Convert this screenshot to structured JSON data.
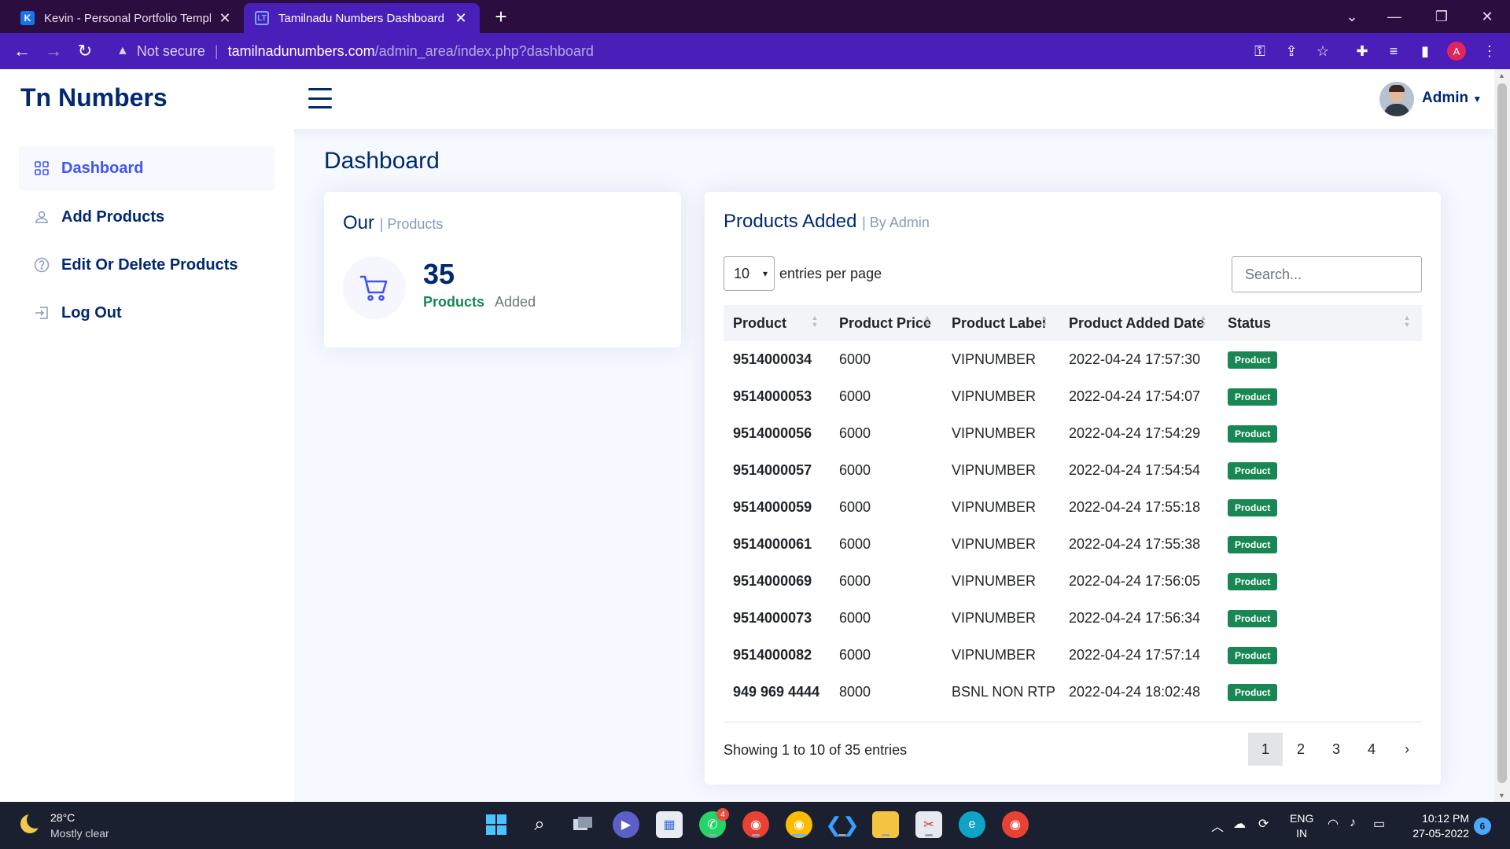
{
  "browser": {
    "tabs": [
      {
        "label": "Kevin - Personal Portfolio Templa",
        "favicon": "K",
        "active": false
      },
      {
        "label": "Tamilnadu Numbers Dashboard",
        "favicon": "LT",
        "active": true
      }
    ],
    "address": {
      "security_label": "Not secure",
      "host": "tamilnadunumbers.com",
      "path": "/admin_area/index.php?dashboard"
    },
    "profile_initial": "A"
  },
  "header": {
    "logo": "Tn Numbers",
    "user_name": "Admin"
  },
  "sidebar": {
    "items": [
      {
        "label": "Dashboard",
        "icon": "grid-icon",
        "active": true
      },
      {
        "label": "Add Products",
        "icon": "person-icon",
        "active": false
      },
      {
        "label": "Edit Or Delete Products",
        "icon": "question-circle-icon",
        "active": false
      },
      {
        "label": "Log Out",
        "icon": "box-arrow-in-icon",
        "active": false
      }
    ]
  },
  "main": {
    "page_title": "Dashboard",
    "products_card": {
      "title": "Our",
      "subtitle": "| Products",
      "count": "35",
      "count_label": "Products",
      "count_suffix": "Added"
    },
    "table_card": {
      "title": "Products Added",
      "subtitle": "| By Admin",
      "per_page_value": "10",
      "per_page_label": "entries per page",
      "search_placeholder": "Search...",
      "columns": [
        "Product",
        "Product Price",
        "Product Label",
        "Product Added Date",
        "Status"
      ],
      "rows": [
        {
          "product": "9514000034",
          "price": "6000",
          "label": "VIPNUMBER",
          "date": "2022-04-24 17:57:30",
          "status": "Product"
        },
        {
          "product": "9514000053",
          "price": "6000",
          "label": "VIPNUMBER",
          "date": "2022-04-24 17:54:07",
          "status": "Product"
        },
        {
          "product": "9514000056",
          "price": "6000",
          "label": "VIPNUMBER",
          "date": "2022-04-24 17:54:29",
          "status": "Product"
        },
        {
          "product": "9514000057",
          "price": "6000",
          "label": "VIPNUMBER",
          "date": "2022-04-24 17:54:54",
          "status": "Product"
        },
        {
          "product": "9514000059",
          "price": "6000",
          "label": "VIPNUMBER",
          "date": "2022-04-24 17:55:18",
          "status": "Product"
        },
        {
          "product": "9514000061",
          "price": "6000",
          "label": "VIPNUMBER",
          "date": "2022-04-24 17:55:38",
          "status": "Product"
        },
        {
          "product": "9514000069",
          "price": "6000",
          "label": "VIPNUMBER",
          "date": "2022-04-24 17:56:05",
          "status": "Product"
        },
        {
          "product": "9514000073",
          "price": "6000",
          "label": "VIPNUMBER",
          "date": "2022-04-24 17:56:34",
          "status": "Product"
        },
        {
          "product": "9514000082",
          "price": "6000",
          "label": "VIPNUMBER",
          "date": "2022-04-24 17:57:14",
          "status": "Product"
        },
        {
          "product": "949 969 4444",
          "price": "8000",
          "label": "BSNL NON RTP",
          "date": "2022-04-24 18:02:48",
          "status": "Product"
        }
      ],
      "showing": "Showing 1 to 10 of 35 entries",
      "pages": [
        "1",
        "2",
        "3",
        "4",
        "›"
      ],
      "current_page": "1"
    }
  },
  "colors": {
    "brand_navy": "#012970",
    "accent_blue": "#4154f1",
    "badge_green": "#198754",
    "browser_purple": "#4a1eb8"
  },
  "taskbar": {
    "weather_temp": "28°C",
    "weather_desc": "Mostly clear",
    "whatsapp_badge": "4",
    "lang_line1": "ENG",
    "lang_line2": "IN",
    "time": "10:12 PM",
    "date": "27-05-2022",
    "notifications": "6"
  }
}
